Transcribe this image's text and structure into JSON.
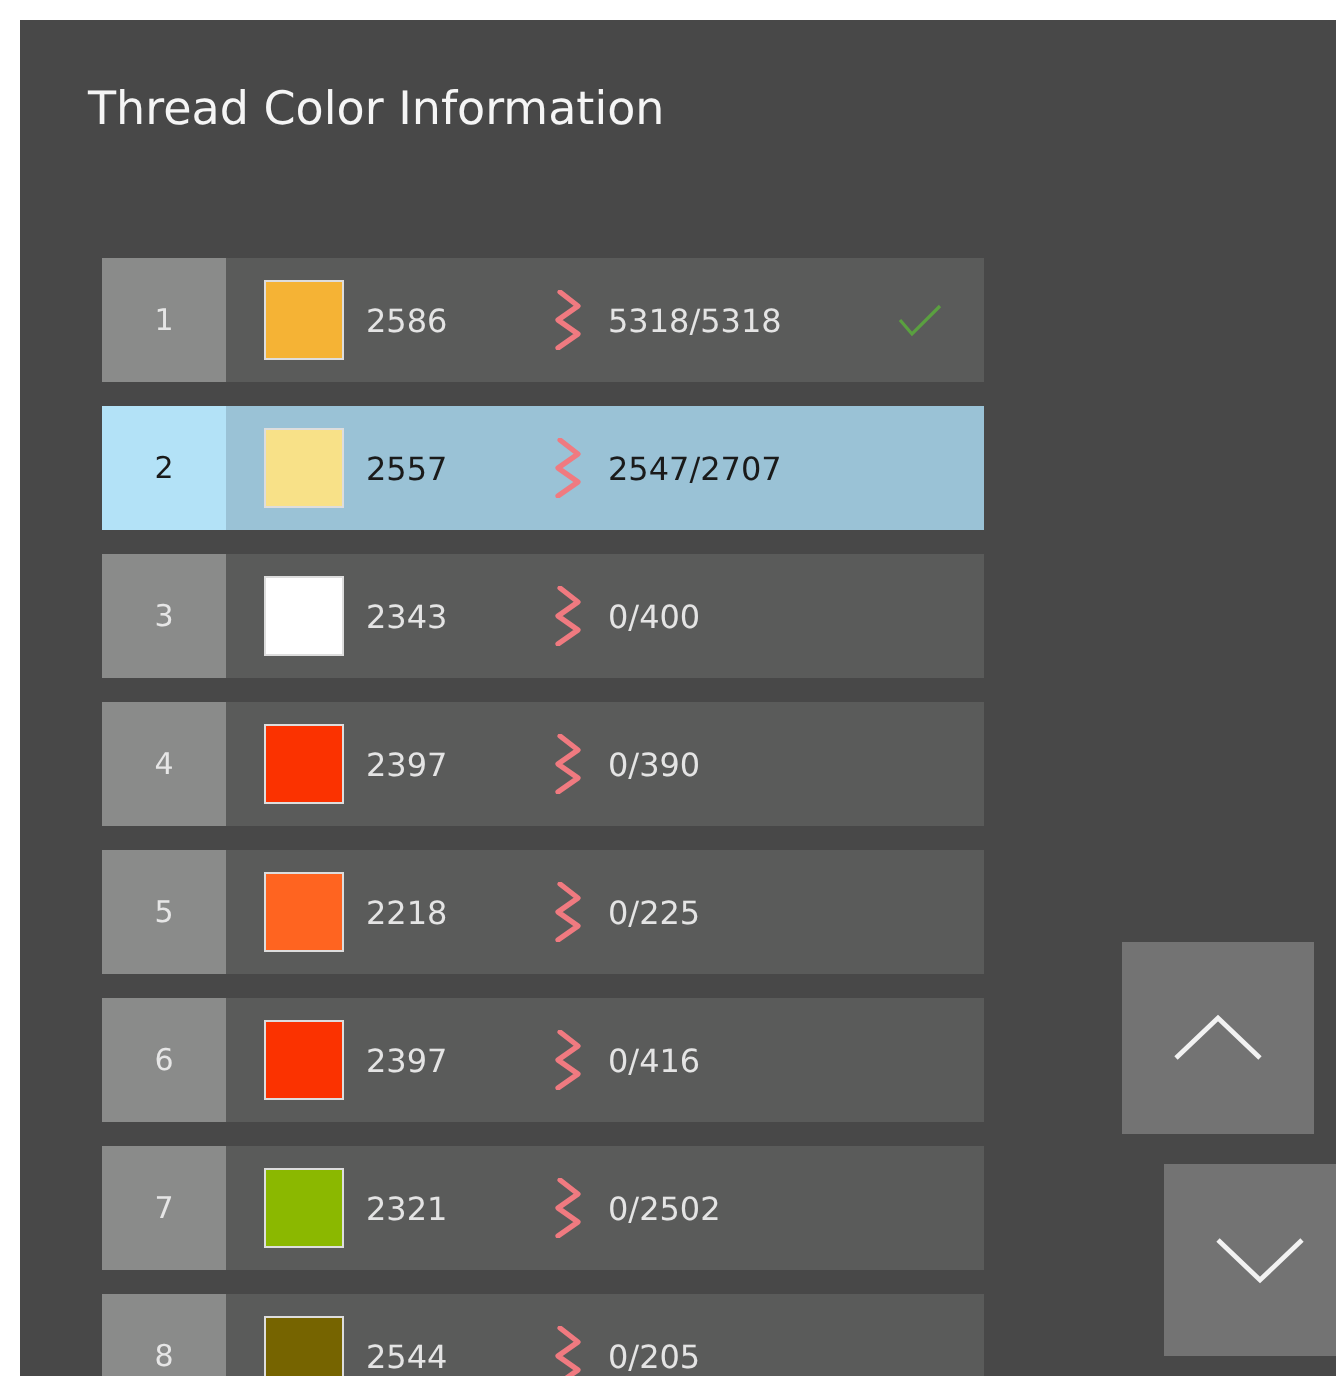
{
  "title": "Thread Color Information",
  "threads": [
    {
      "number": "1",
      "color": "#f5b335",
      "code": "2586",
      "stitches": "5318/5318",
      "completed": true,
      "selected": false
    },
    {
      "number": "2",
      "color": "#f8e188",
      "code": "2557",
      "stitches": "2547/2707",
      "completed": false,
      "selected": true
    },
    {
      "number": "3",
      "color": "#ffffff",
      "code": "2343",
      "stitches": "0/400",
      "completed": false,
      "selected": false
    },
    {
      "number": "4",
      "color": "#fb3200",
      "code": "2397",
      "stitches": "0/390",
      "completed": false,
      "selected": false
    },
    {
      "number": "5",
      "color": "#ff6420",
      "code": "2218",
      "stitches": "0/225",
      "completed": false,
      "selected": false
    },
    {
      "number": "6",
      "color": "#fb3200",
      "code": "2397",
      "stitches": "0/416",
      "completed": false,
      "selected": false
    },
    {
      "number": "7",
      "color": "#8bb800",
      "code": "2321",
      "stitches": "0/2502",
      "completed": false,
      "selected": false
    },
    {
      "number": "8",
      "color": "#766400",
      "code": "2544",
      "stitches": "0/205",
      "completed": false,
      "selected": false
    }
  ]
}
